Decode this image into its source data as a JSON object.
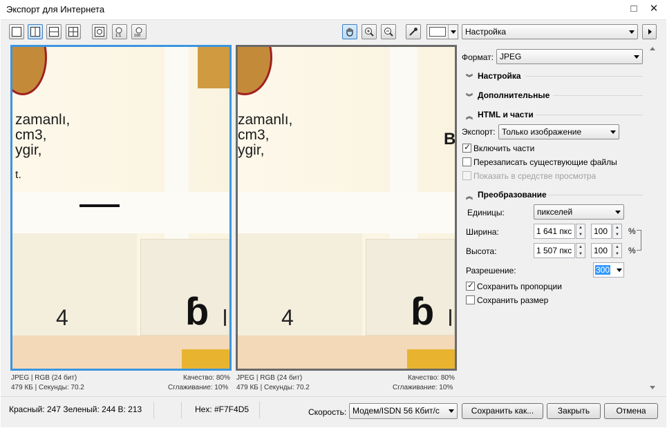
{
  "window": {
    "title": "Экспорт для Интернета",
    "maximize_icon": "□",
    "close_icon": "✕"
  },
  "toolbar": {
    "preset": "Настройка"
  },
  "panel": {
    "format_label": "Формат:",
    "format_value": "JPEG",
    "sections": {
      "settings": "Настройка",
      "advanced": "Дополнительные",
      "html": "HTML и части",
      "transform": "Преобразование"
    },
    "export_label": "Экспорт:",
    "export_value": "Только изображение",
    "include_parts": "Включить части",
    "overwrite": "Перезаписать существующие файлы",
    "show_in_viewer": "Показать в средстве просмотра",
    "units_label": "Единицы:",
    "units_value": "пикселей",
    "width_label": "Ширина:",
    "width_value": "1 641 пкс",
    "width_pct": "100",
    "height_label": "Высота:",
    "height_value": "1 507 пкс",
    "height_pct": "100",
    "percent": "%",
    "resolution_label": "Разрешение:",
    "resolution_value": "300",
    "keep_ratio": "Сохранить пропорции",
    "keep_size": "Сохранить размер"
  },
  "preview_left": {
    "line1": "JPEG  |  RGB (24 бит)",
    "line2": "479 КБ  |  Секунды: 70.2",
    "quality": "Качество: 80%",
    "smoothing": "Сглаживание: 10%"
  },
  "preview_right": {
    "line1": "JPEG  |  RGB (24 бит)",
    "line2": "479 КБ  |  Секунды: 70.2",
    "quality": "Качество: 80%",
    "smoothing": "Сглаживание: 10%"
  },
  "preview_text": {
    "l1": "zamanlı,",
    "l2": "cm3,",
    "l3": "ygir,",
    "l4": "t.",
    "digit": "4",
    "b": "B",
    "big": "ɓ"
  },
  "status": {
    "color": "Красный: 247  Зеленый: 244  B: 213",
    "hex": "Hex: #F7F4D5",
    "speed_label": "Скорость:",
    "speed_value": "Модем/ISDN 56 Кбит/с"
  },
  "buttons": {
    "save_as": "Сохранить как...",
    "close": "Закрыть",
    "cancel": "Отмена"
  }
}
